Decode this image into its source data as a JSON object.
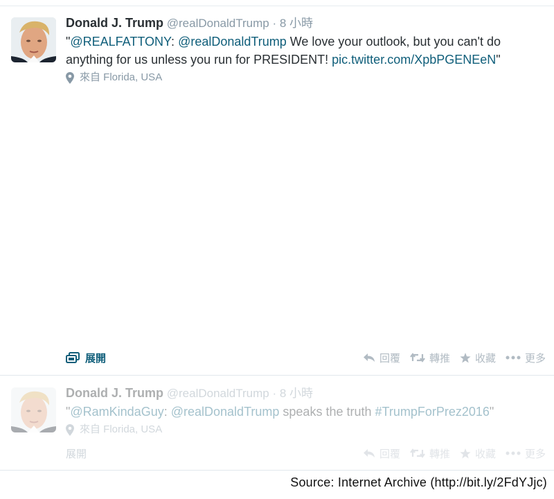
{
  "tweets": [
    {
      "author_name": "Donald J. Trump",
      "handle": "@realDonaldTrump",
      "separator": "·",
      "time": "8 小時",
      "text": [
        {
          "t": "\"",
          "link": false
        },
        {
          "t": "@REALFATTONY",
          "link": true
        },
        {
          "t": ": ",
          "link": false
        },
        {
          "t": "@realDonaldTrump",
          "link": true
        },
        {
          "t": " We love your outlook, but you can't do anything for us unless you run for PRESIDENT! ",
          "link": false
        },
        {
          "t": "pic.twitter.com/XpbPGENEeN",
          "link": true
        },
        {
          "t": "\"",
          "link": false
        }
      ],
      "location": "來自 Florida, USA",
      "expand_label": "展開",
      "actions": [
        "回覆",
        "轉推",
        "收藏",
        "更多"
      ]
    },
    {
      "author_name": "Donald J. Trump",
      "handle": "@realDonaldTrump",
      "separator": "·",
      "time": "8 小時",
      "text": [
        {
          "t": "\"",
          "link": false
        },
        {
          "t": "@RamKindaGuy",
          "link": true
        },
        {
          "t": ": ",
          "link": false
        },
        {
          "t": "@realDonaldTrump",
          "link": true
        },
        {
          "t": " speaks the truth ",
          "link": false
        },
        {
          "t": "#TrumpForPrez2016",
          "link": true
        },
        {
          "t": "\"",
          "link": false
        }
      ],
      "location": "來自 Florida, USA",
      "expand_label": "展開",
      "actions": [
        "回覆",
        "轉推",
        "收藏",
        "更多"
      ]
    }
  ],
  "icons": {
    "location": "map-pin-icon",
    "expand": "media-stack-icon",
    "reply": "reply-icon",
    "retweet": "retweet-icon",
    "favorite": "star-icon",
    "more": "more-dots-icon"
  },
  "colors": {
    "link": "#0f5e7a",
    "muted": "#8899a6",
    "action": "#b1bbc3"
  },
  "source_caption": "Source: Internet Archive (http://bit.ly/2FdYJjc)"
}
